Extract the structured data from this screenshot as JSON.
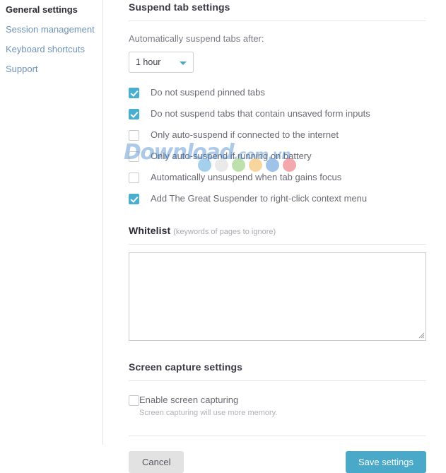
{
  "sidebar": {
    "items": [
      {
        "label": "General settings",
        "active": true
      },
      {
        "label": "Session management",
        "active": false
      },
      {
        "label": "Keyboard shortcuts",
        "active": false
      },
      {
        "label": "Support",
        "active": false
      }
    ]
  },
  "suspend_section": {
    "title": "Suspend tab settings",
    "select_label": "Automatically suspend tabs after:",
    "select_value": "1 hour",
    "select_options": [
      "1 hour"
    ],
    "checkboxes": [
      {
        "label": "Do not suspend pinned tabs",
        "checked": true
      },
      {
        "label": "Do not suspend tabs that contain unsaved form inputs",
        "checked": true
      },
      {
        "label": "Only auto-suspend if connected to the internet",
        "checked": false
      },
      {
        "label": "Only auto-suspend if running on battery",
        "checked": false
      },
      {
        "label": "Automatically unsuspend when tab gains focus",
        "checked": false
      },
      {
        "label": "Add The Great Suspender to right-click context menu",
        "checked": true
      }
    ]
  },
  "whitelist_section": {
    "title": "Whitelist",
    "title_note": "(keywords of pages to ignore)",
    "value": "",
    "placeholder": ""
  },
  "screen_capture_section": {
    "title": "Screen capture settings",
    "checkbox_label": "Enable screen capturing",
    "checkbox_sub": "Screen capturing will use more memory.",
    "checked": false
  },
  "footer": {
    "cancel_label": "Cancel",
    "save_label": "Save settings"
  },
  "watermark": {
    "text_main": "Download",
    "text_suffix": ".com.vn",
    "dot_colors": [
      "#5aa9e0",
      "#d8d8d8",
      "#86c76a",
      "#f0b24a",
      "#4e8fd6",
      "#e8616a"
    ]
  },
  "colors": {
    "accent": "#4aa8c8",
    "checkbox_checked": "#4aaed0",
    "sidebar_link": "#6f93b8",
    "cancel_bg": "#e2e2e2"
  }
}
